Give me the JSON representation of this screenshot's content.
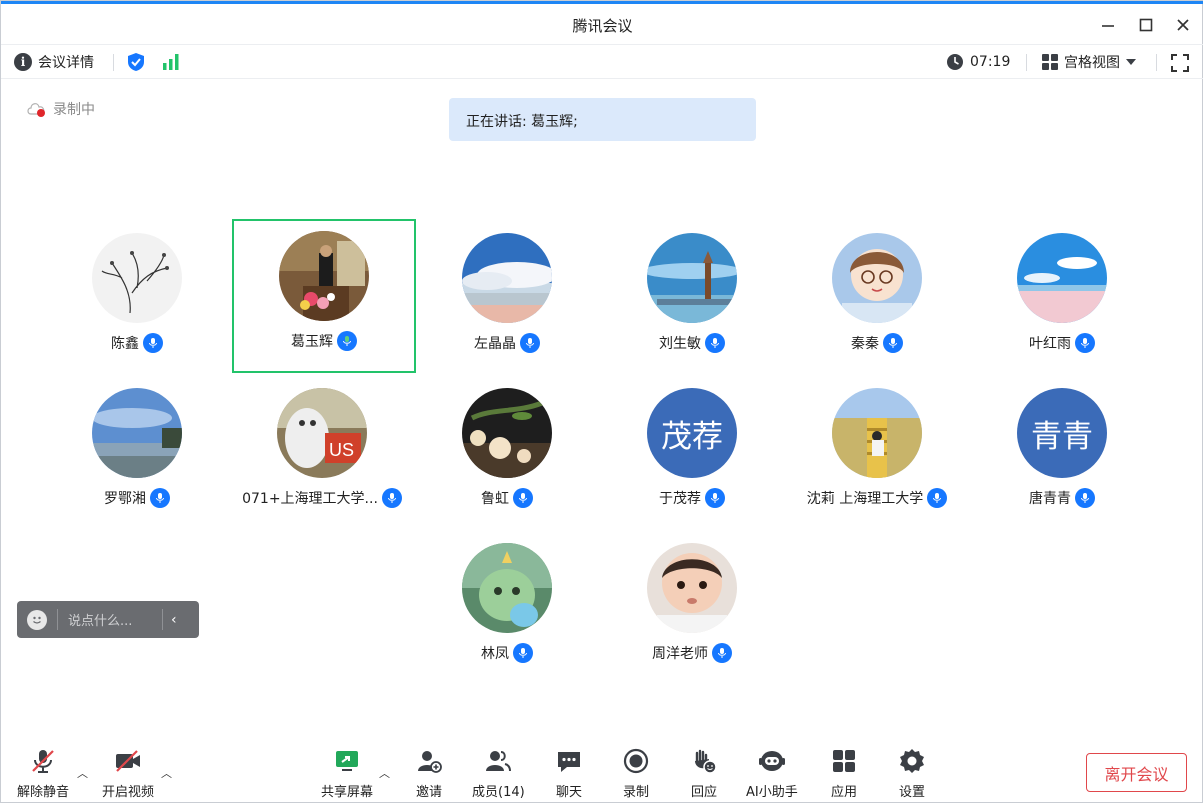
{
  "window": {
    "title": "腾讯会议"
  },
  "infobar": {
    "details_label": "会议详情",
    "time": "07:19",
    "view_label": "宫格视图"
  },
  "recording": {
    "label": "录制中"
  },
  "speaking": {
    "text": "正在讲话: 葛玉辉;"
  },
  "participants": [
    {
      "name": "陈鑫"
    },
    {
      "name": "葛玉辉"
    },
    {
      "name": "左晶晶"
    },
    {
      "name": "刘生敏"
    },
    {
      "name": "秦秦"
    },
    {
      "name": "叶红雨"
    },
    {
      "name": "罗鄂湘"
    },
    {
      "name": "071+上海理工大学..."
    },
    {
      "name": "鲁虹"
    },
    {
      "name": "于茂荐",
      "initials": "茂荐"
    },
    {
      "name": "沈莉 上海理工大学"
    },
    {
      "name": "唐青青",
      "initials": "青青"
    },
    {
      "name": "林凤"
    },
    {
      "name": "周洋老师"
    }
  ],
  "chat": {
    "placeholder": "说点什么...",
    "collapse": "‹"
  },
  "toolbar": {
    "unmute": "解除静音",
    "start_video": "开启视频",
    "share_screen": "共享屏幕",
    "invite": "邀请",
    "members": "成员(14)",
    "chat": "聊天",
    "record": "录制",
    "react": "回应",
    "ai": "AI小助手",
    "apps": "应用",
    "settings": "设置",
    "leave": "离开会议"
  },
  "colors": {
    "accent": "#1677ff",
    "active_border": "#22c36a",
    "leave": "#e0474b",
    "banner": "#dbe9fb"
  }
}
